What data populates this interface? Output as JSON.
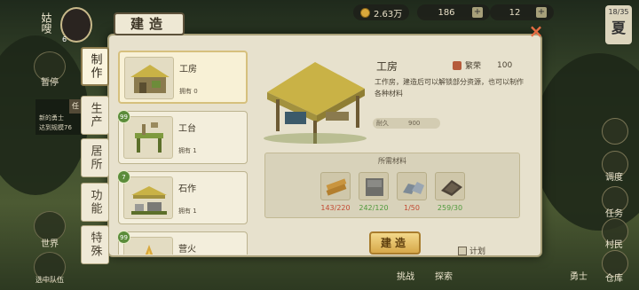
{
  "hud": {
    "currency": "2.63万",
    "stat_a": "186",
    "stat_b": "12",
    "season_date": "18/35",
    "season_word": "夏"
  },
  "left_hud": {
    "player_name": "姑嗖",
    "level": "6",
    "tab_quest": "暂停",
    "quest_tab": "任",
    "quest_lines": [
      "新的勇士",
      "达到规模76"
    ],
    "world": "世界",
    "team": "选中队伍"
  },
  "right_hud": {
    "items": [
      "调度",
      "任务",
      "村民",
      "仓库"
    ]
  },
  "bottom_hud": {
    "items": [
      "挑战",
      "探索",
      "勇士"
    ]
  },
  "modal": {
    "title": "建造",
    "close": "×",
    "tabs": [
      {
        "label": "制作",
        "active": true
      },
      {
        "label": "生产",
        "active": false
      },
      {
        "label": "居所",
        "active": false
      },
      {
        "label": "功能",
        "active": false
      },
      {
        "label": "特殊",
        "active": false
      }
    ],
    "buildings": [
      {
        "name": "工房",
        "owned": "拥有 0",
        "badge": ""
      },
      {
        "name": "工台",
        "owned": "拥有 1",
        "badge": "99"
      },
      {
        "name": "石作",
        "owned": "拥有 1",
        "badge": "7"
      },
      {
        "name": "营火",
        "owned": "",
        "badge": "99"
      }
    ],
    "detail": {
      "name": "工房",
      "prosperity_label": "繁荣",
      "prosperity_value": "100",
      "description": "工作房，建造后可以解锁部分资源，也可以制作各种材料",
      "durability_label": "耐久",
      "durability_value": "900"
    },
    "materials": {
      "title": "所需材料",
      "items": [
        {
          "icon": "wood-plank-icon",
          "count": "143/220",
          "status": "red"
        },
        {
          "icon": "stone-block-icon",
          "count": "242/120",
          "status": "green"
        },
        {
          "icon": "iron-ore-icon",
          "count": "1/50",
          "status": "red"
        },
        {
          "icon": "cloth-icon",
          "count": "259/30",
          "status": "green"
        }
      ]
    },
    "build_label": "建造",
    "plan_label": "计划"
  },
  "colors": {
    "panel": "#e7e1cd",
    "accent": "#d7a94a",
    "close": "#e66d43",
    "insufficient": "#c34a33",
    "sufficient": "#4f9a3c"
  }
}
